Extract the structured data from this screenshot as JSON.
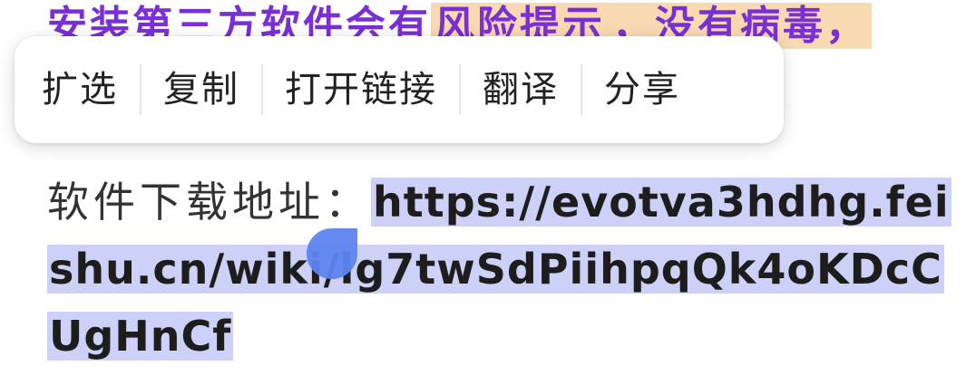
{
  "article": {
    "top_line": "安装第三方软件会有",
    "top_line_highlight": "风险提示",
    "top_line_rest": "，没有病毒，"
  },
  "context_menu": {
    "items": [
      "扩选",
      "复制",
      "打开链接",
      "翻译",
      "分享"
    ]
  },
  "download": {
    "label": "软件下载地址：",
    "url_line1": "https://evotva3hdhg.fei",
    "url_line2": "shu.cn/wiki/lg7twSdPiihpqQk4oKDcC",
    "url_line3": "UgHnCf"
  },
  "colors": {
    "selection": "#cdd1f7",
    "handle": "#5d85f0",
    "top_text": "#7a2fd6",
    "top_highlight": "#f9d9b2"
  },
  "icons": {
    "selection_handle": "selection-handle-icon"
  }
}
